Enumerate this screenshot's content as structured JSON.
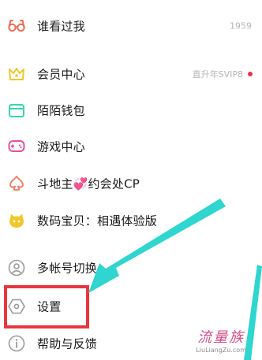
{
  "menu": {
    "items": [
      {
        "id": "visitors",
        "label": "谁看过我",
        "value": "1959",
        "icon": "glasses-icon",
        "icon_color": "#f06a55"
      },
      {
        "id": "vip",
        "label": "会员中心",
        "value": "直升年SVIP8",
        "icon": "crown-icon",
        "icon_color": "#f2c72a",
        "badge_dot": true
      },
      {
        "id": "wallet",
        "label": "陌陌钱包",
        "icon": "wallet-icon",
        "icon_color": "#33d6b4"
      },
      {
        "id": "games",
        "label": "游戏中心",
        "icon": "gamepad-icon",
        "icon_color": "#e84ea0"
      },
      {
        "id": "cp",
        "label": "斗地主💞约会处CP",
        "icon": "spade-icon",
        "icon_color": "#f07a5a"
      },
      {
        "id": "pet",
        "label": "数码宝贝：相遇体验版",
        "icon": "pet-icon",
        "icon_color": "#f2c72a"
      },
      {
        "id": "switch",
        "label": "多帐号切换",
        "icon": "account-switch-icon",
        "icon_color": "#9a9a9a"
      },
      {
        "id": "settings",
        "label": "设置",
        "icon": "settings-hexagon-icon",
        "icon_color": "#9a9a9a"
      },
      {
        "id": "help",
        "label": "帮助与反馈",
        "icon": "info-icon",
        "icon_color": "#9a9a9a"
      }
    ]
  },
  "annotation": {
    "highlight_color": "#e8363e",
    "arrow_color": "#2fd6d0"
  },
  "watermark": {
    "title": "流量族",
    "subtitle": "LiuLiangZu.com"
  }
}
